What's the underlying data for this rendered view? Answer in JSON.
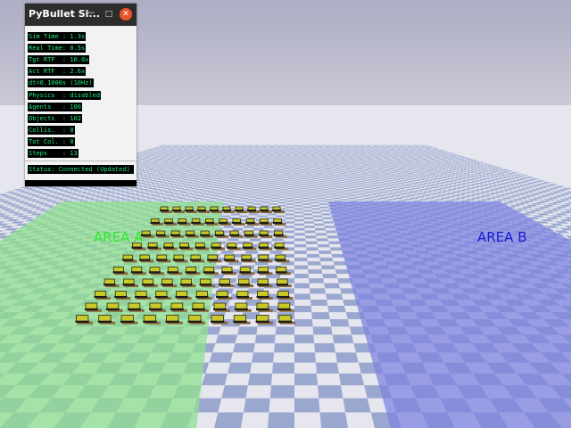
{
  "window": {
    "title": "PyBullet Si...",
    "minimize_icon": "minimize-icon",
    "maximize_icon": "maximize-icon",
    "close_icon": "close-icon"
  },
  "stats": [
    {
      "name": "stat-sim-time",
      "text": "Sim Time : 1.3s"
    },
    {
      "name": "stat-real-time",
      "text": "Real Time: 0.5s"
    },
    {
      "name": "stat-tgt-rtf",
      "text": "Tgt RTF  : 10.0x"
    },
    {
      "name": "stat-act-rtf",
      "text": "Act RTF  : 2.6x"
    },
    {
      "name": "stat-dt",
      "text": "dt=0.1000s (10Hz)"
    },
    {
      "name": "stat-physics",
      "text": "Physics  : disabled"
    },
    {
      "name": "stat-agents",
      "text": "Agents   : 100"
    },
    {
      "name": "stat-objects",
      "text": "Objects  : 102"
    },
    {
      "name": "stat-collis",
      "text": "Collis.  : 0"
    },
    {
      "name": "stat-tot-col",
      "text": "Tot Col. : 0"
    },
    {
      "name": "stat-steps",
      "text": "Steps    : 13"
    }
  ],
  "status": "Status: Connected (Updated)",
  "areas": {
    "a": "AREA A",
    "b": "AREA B"
  },
  "colors": {
    "sky": "#b9b9c9",
    "area_a": "#8fe08f",
    "area_b": "#7f86e0",
    "floor_dark": "#9aa8cf",
    "floor_light": "#e6e6ee",
    "robot": "#c9c92a",
    "stat_text": "#1fe87a"
  }
}
